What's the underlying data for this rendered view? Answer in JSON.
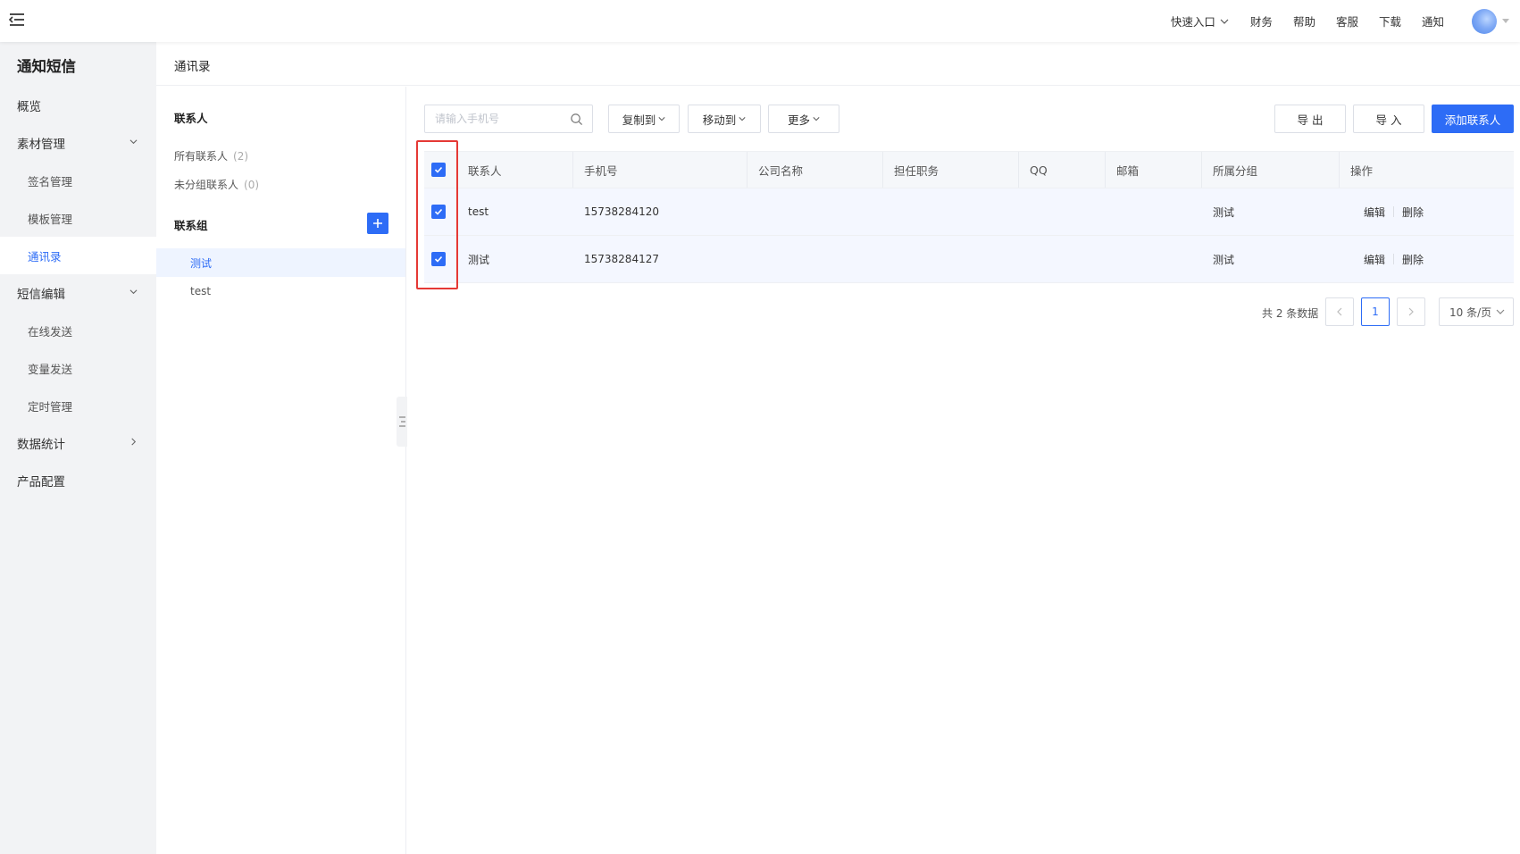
{
  "topbar": {
    "quick_entry": "快速入口",
    "links": [
      "财务",
      "帮助",
      "客服",
      "下载",
      "通知"
    ]
  },
  "sidebar": {
    "title": "通知短信",
    "items": [
      {
        "label": "概览"
      },
      {
        "label": "素材管理"
      },
      {
        "label": "签名管理"
      },
      {
        "label": "模板管理"
      },
      {
        "label": "通讯录"
      },
      {
        "label": "短信编辑"
      },
      {
        "label": "在线发送"
      },
      {
        "label": "变量发送"
      },
      {
        "label": "定时管理"
      },
      {
        "label": "数据统计"
      },
      {
        "label": "产品配置"
      }
    ]
  },
  "page": {
    "title": "通讯录"
  },
  "contacts": {
    "heading": "联系人",
    "all_label": "所有联系人",
    "all_count": "(2)",
    "ungrouped_label": "未分组联系人",
    "ungrouped_count": "(0)",
    "groups_heading": "联系组",
    "groups": [
      "测试",
      "test"
    ]
  },
  "toolbar": {
    "search_placeholder": "请输入手机号",
    "copy_to": "复制到",
    "move_to": "移动到",
    "more": "更多",
    "export": "导 出",
    "import": "导 入",
    "add_contact": "添加联系人"
  },
  "table": {
    "columns": [
      "联系人",
      "手机号",
      "公司名称",
      "担任职务",
      "QQ",
      "邮箱",
      "所属分组",
      "操作"
    ],
    "rows": [
      {
        "name": "test",
        "phone": "15738284120",
        "company": "",
        "title": "",
        "qq": "",
        "email": "",
        "group": "测试"
      },
      {
        "name": "测试",
        "phone": "15738284127",
        "company": "",
        "title": "",
        "qq": "",
        "email": "",
        "group": "测试"
      }
    ],
    "edit_label": "编辑",
    "delete_label": "删除"
  },
  "pagination": {
    "total": "共 2 条数据",
    "current_page": "1",
    "page_size": "10 条/页"
  },
  "colors": {
    "primary": "#2d6cf6",
    "highlight": "#e53935",
    "sidebar_bg": "#f2f3f5"
  }
}
